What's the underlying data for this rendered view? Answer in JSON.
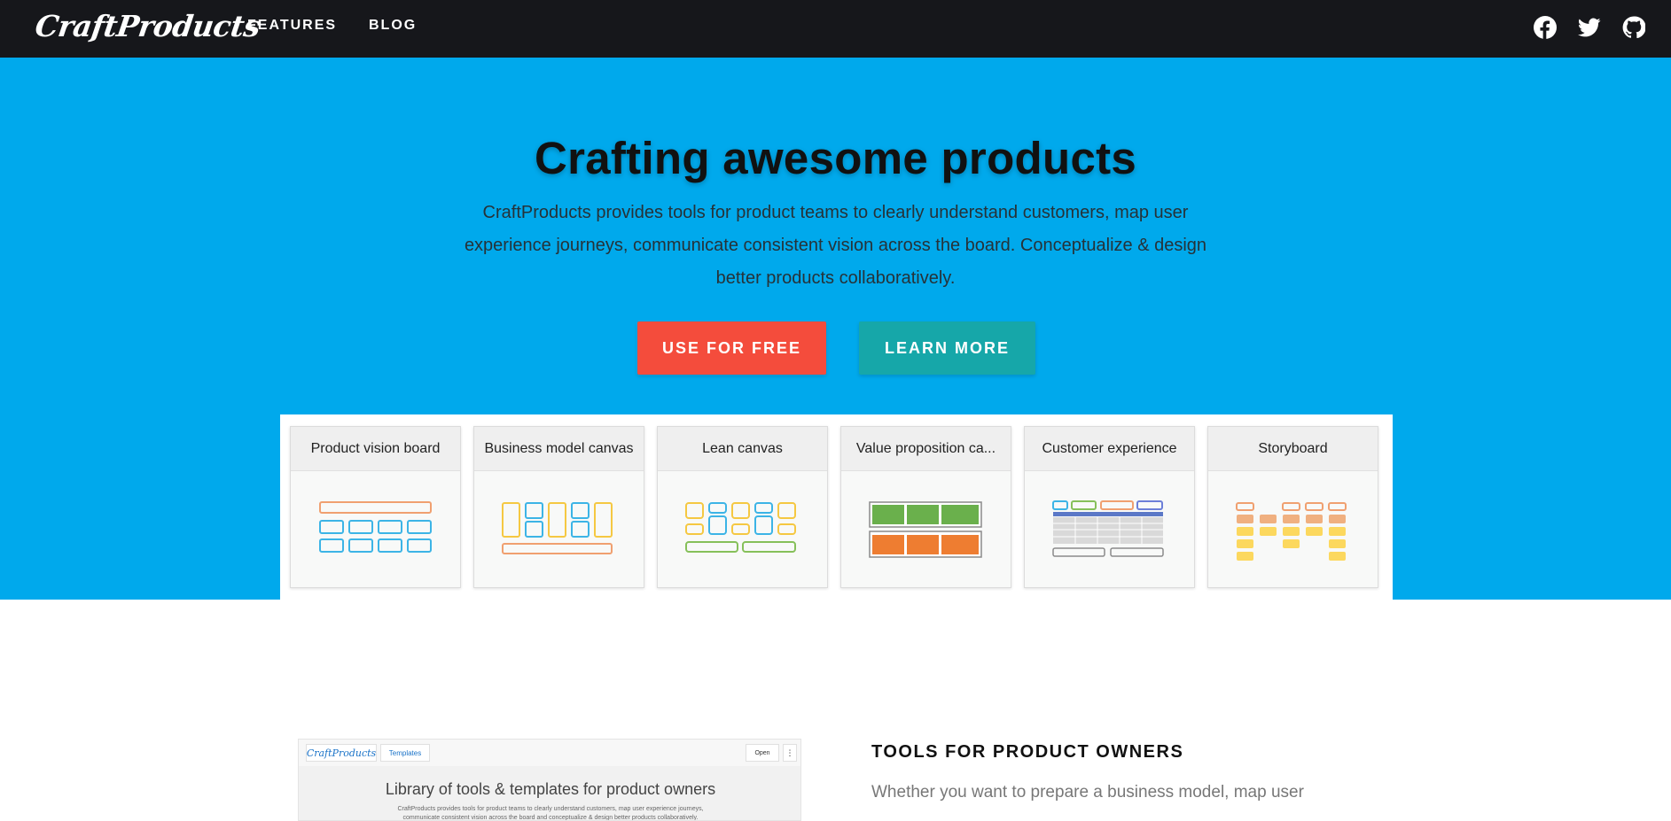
{
  "nav": {
    "logo": "CraftProducts",
    "links": [
      "FEATURES",
      "BLOG"
    ],
    "social_icons": [
      "facebook-icon",
      "twitter-icon",
      "github-icon"
    ]
  },
  "hero": {
    "title": "Crafting awesome products",
    "description": "CraftProducts provides tools for product teams to clearly understand customers, map user experience journeys, communicate consistent vision across the board. Conceptualize & design better products collaboratively.",
    "primary_button": "USE FOR FREE",
    "secondary_button": "LEARN MORE"
  },
  "templates": [
    {
      "title": "Product vision board"
    },
    {
      "title": "Business model canvas"
    },
    {
      "title": "Lean canvas"
    },
    {
      "title": "Value proposition ca..."
    },
    {
      "title": "Customer experience"
    },
    {
      "title": "Storyboard"
    }
  ],
  "preview": {
    "logo": "CraftProducts",
    "tab": "Templates",
    "open_button": "Open",
    "more_button": "⋮",
    "title": "Library of tools & templates for product owners",
    "text": "CraftProducts provides tools for product teams to clearly understand customers, map user experience journeys, communicate consistent vision across the board and conceptualize & design better products collaboratively."
  },
  "tools": {
    "title": "TOOLS FOR PRODUCT OWNERS",
    "text": "Whether you want to prepare a business model, map user"
  },
  "colors": {
    "nav_bg": "#16171b",
    "hero_bg": "#00a9ec",
    "primary_button": "#f44c3c",
    "secondary_button": "#16a7a9"
  }
}
